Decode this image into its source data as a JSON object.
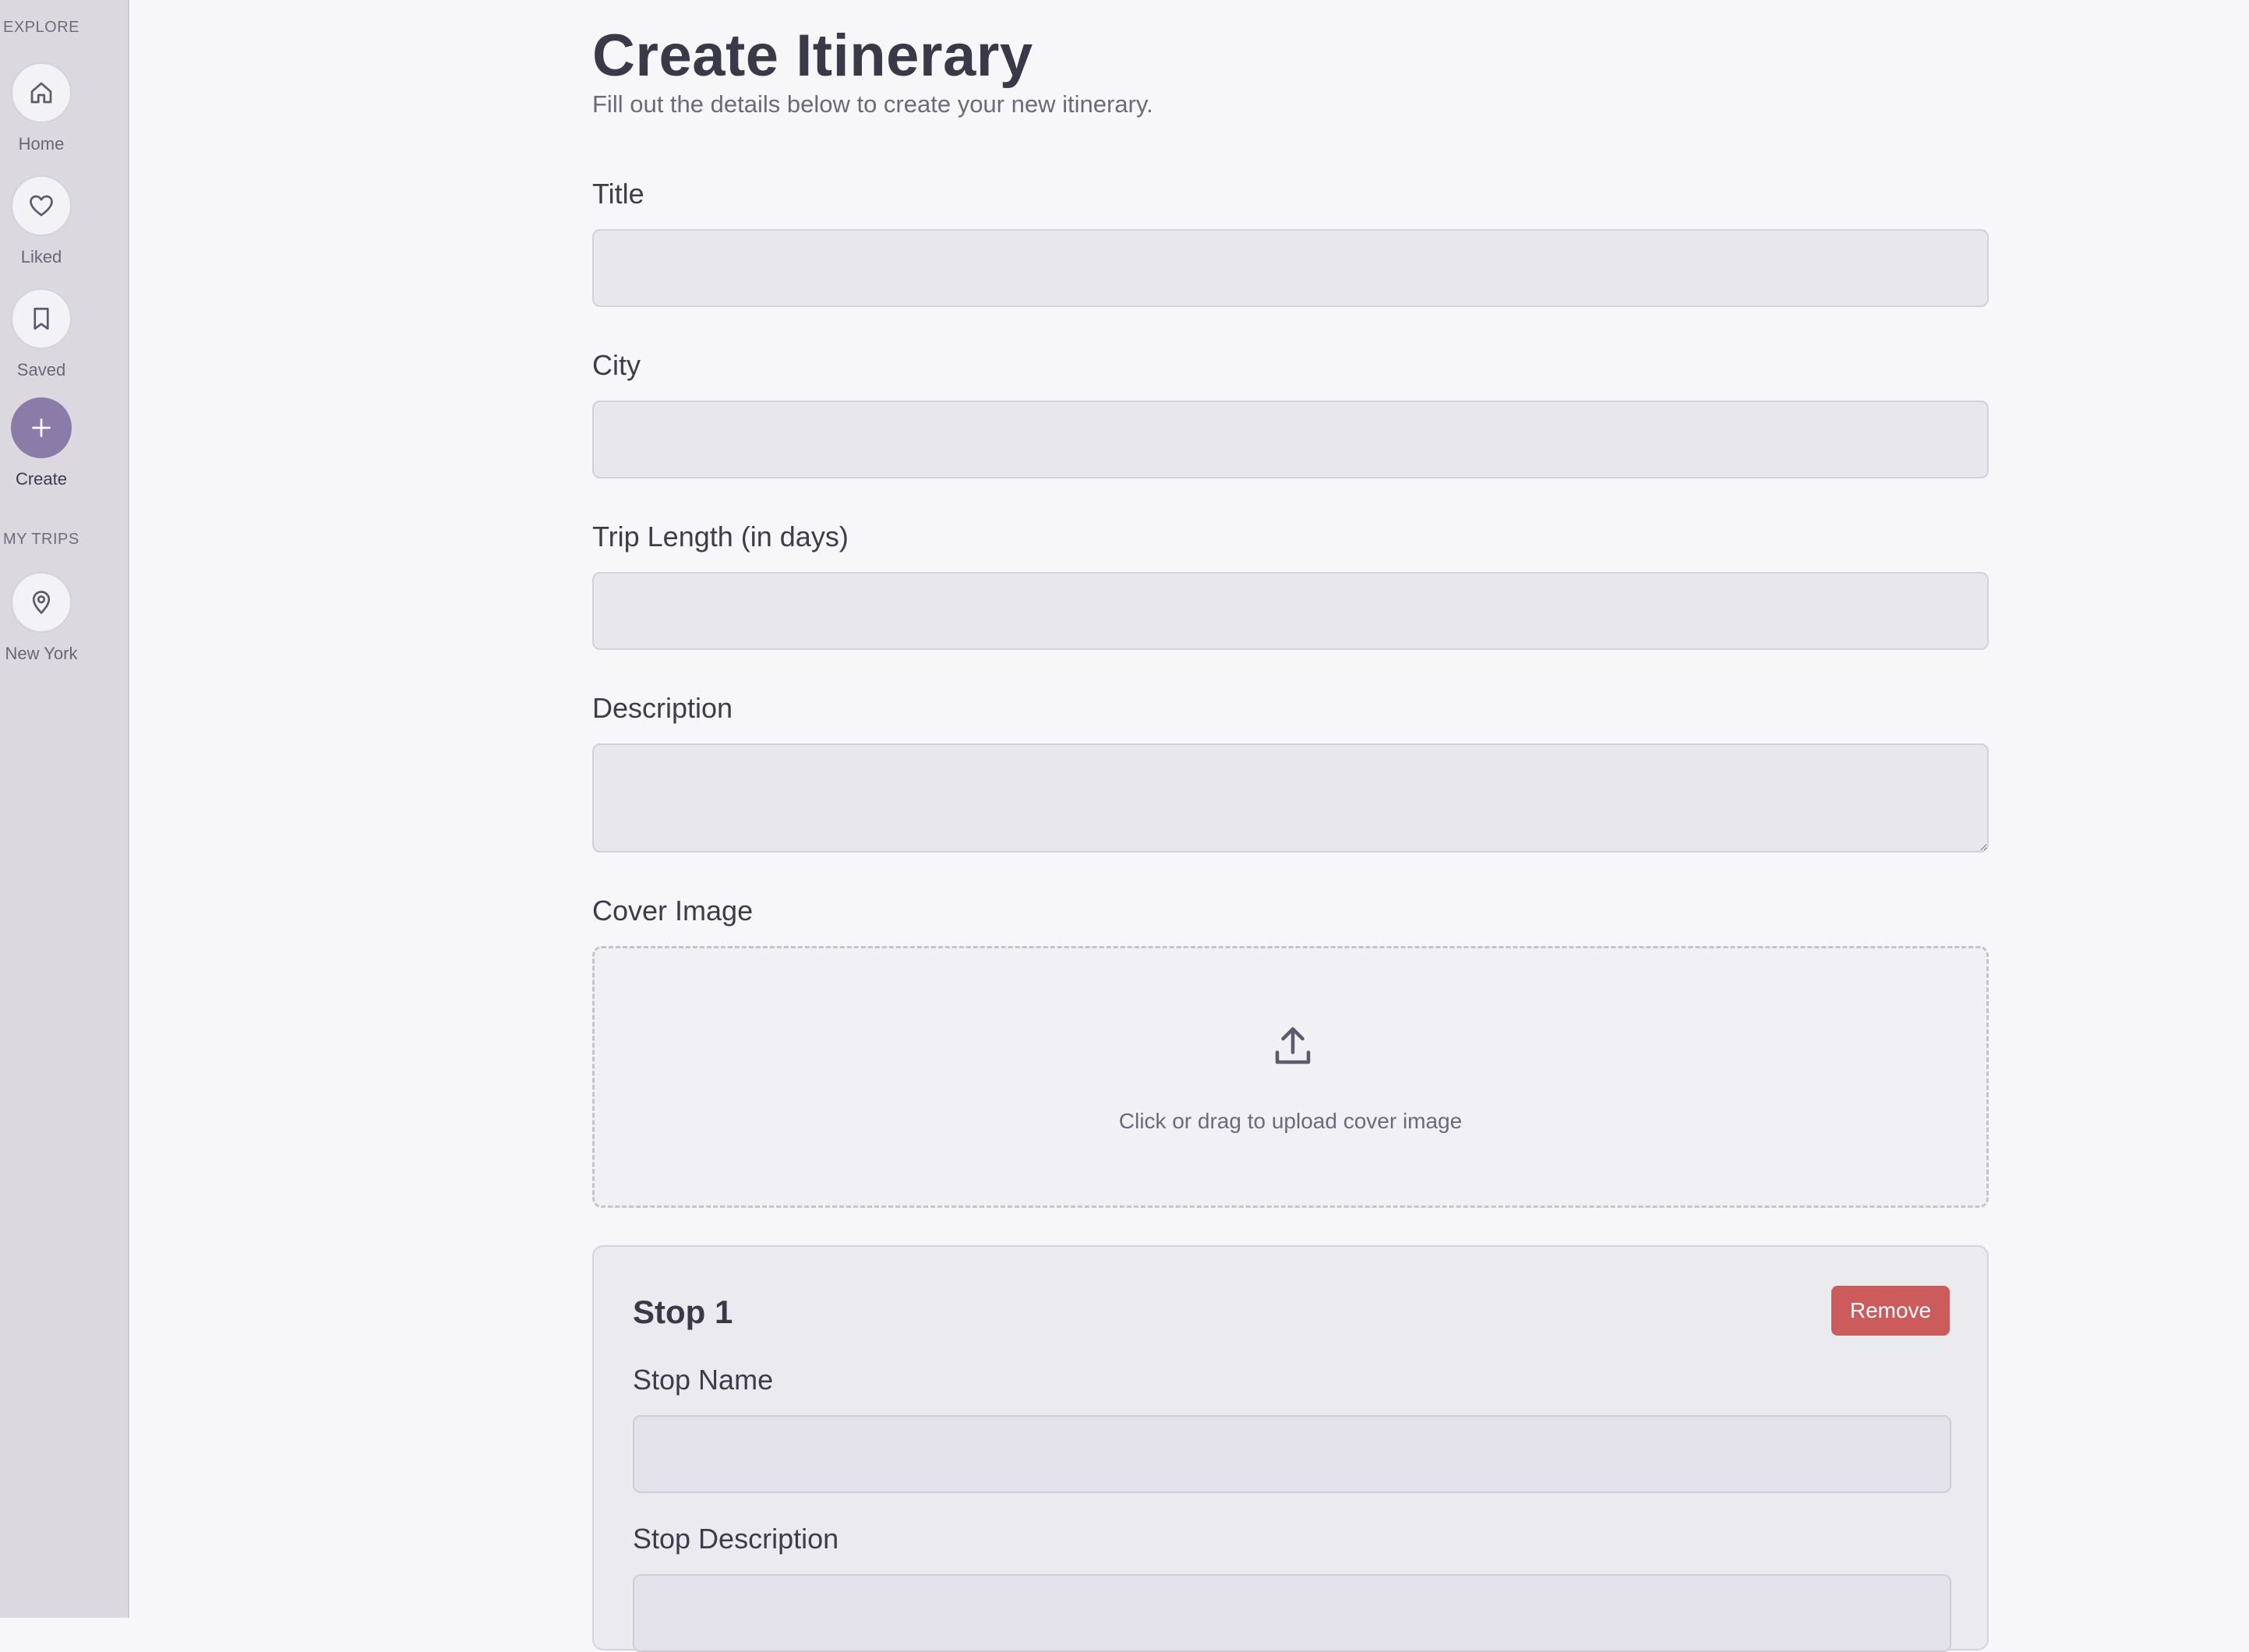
{
  "sidebar": {
    "explore_heading": "EXPLORE",
    "items": [
      {
        "label": "Home",
        "icon": "home-icon"
      },
      {
        "label": "Liked",
        "icon": "heart-icon"
      },
      {
        "label": "Saved",
        "icon": "bookmark-icon"
      },
      {
        "label": "Create",
        "icon": "plus-icon",
        "active": true
      }
    ],
    "trips_heading": "MY TRIPS",
    "trips": [
      {
        "label": "New York",
        "icon": "map-pin-icon"
      }
    ]
  },
  "form": {
    "title": "Create Itinerary",
    "subtitle": "Fill out the details below to create your new itinerary.",
    "fields": {
      "title_label": "Title",
      "title_value": "",
      "city_label": "City",
      "city_value": "",
      "trip_length_label": "Trip Length (in days)",
      "trip_length_value": "",
      "description_label": "Description",
      "description_value": "",
      "cover_image_label": "Cover Image",
      "upload_text": "Click or drag to upload cover image"
    },
    "stop": {
      "title": "Stop 1",
      "remove_label": "Remove",
      "name_label": "Stop Name",
      "description_label": "Stop Description"
    }
  },
  "colors": {
    "accent": "#8a7ba8",
    "danger": "#cc5c5c",
    "sidebar_bg": "#dcd8df"
  }
}
